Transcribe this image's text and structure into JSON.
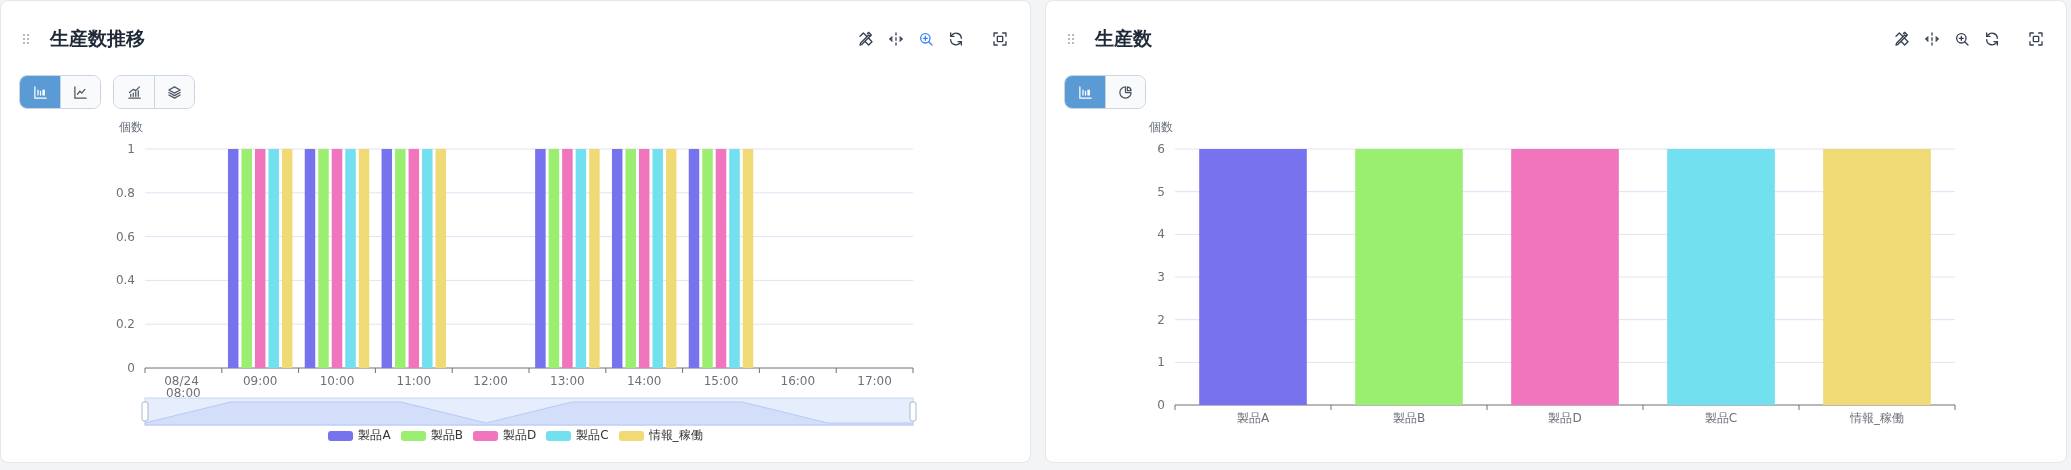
{
  "panels": [
    {
      "title": "生産数推移",
      "toolbar": [
        {
          "kind": "edit",
          "active": false
        },
        {
          "kind": "move",
          "active": false
        },
        {
          "kind": "zoom",
          "active": true
        },
        {
          "kind": "refresh",
          "active": false
        },
        {
          "kind": "fullscreen",
          "active": false
        }
      ],
      "view_groups": [
        [
          {
            "kind": "bar",
            "selected": true
          },
          {
            "kind": "line",
            "selected": false
          }
        ],
        [
          {
            "kind": "trend",
            "selected": false
          },
          {
            "kind": "stack",
            "selected": false
          }
        ]
      ],
      "zoom_slider": true,
      "chart_data": {
        "type": "bar",
        "ylabel": "個数",
        "categories": [
          "08/24 08:00",
          "09:00",
          "10:00",
          "11:00",
          "12:00",
          "13:00",
          "14:00",
          "15:00",
          "16:00",
          "17:00"
        ],
        "yticks": [
          {
            "value": 0,
            "label": "0"
          },
          {
            "value": 0.2,
            "label": "0.2"
          },
          {
            "value": 0.4,
            "label": "0.4"
          },
          {
            "value": 0.6,
            "label": "0.6"
          },
          {
            "value": 0.8,
            "label": "0.8"
          },
          {
            "value": 1,
            "label": "1"
          }
        ],
        "ylim": [
          0,
          1
        ],
        "grid": true,
        "legend": "bottom",
        "series": [
          {
            "name": "製品A",
            "color": "#7773ef",
            "values": [
              0,
              1,
              1,
              1,
              0,
              1,
              1,
              1,
              0,
              0
            ]
          },
          {
            "name": "製品B",
            "color": "#9bef70",
            "values": [
              0,
              1,
              1,
              1,
              0,
              1,
              1,
              1,
              0,
              0
            ]
          },
          {
            "name": "製品D",
            "color": "#f075bc",
            "values": [
              0,
              1,
              1,
              1,
              0,
              1,
              1,
              1,
              0,
              0
            ]
          },
          {
            "name": "製品C",
            "color": "#73e0ef",
            "values": [
              0,
              1,
              1,
              1,
              0,
              1,
              1,
              1,
              0,
              0
            ]
          },
          {
            "name": "情報_稼働",
            "color": "#f0da76",
            "values": [
              0,
              1,
              1,
              1,
              0,
              1,
              1,
              1,
              0,
              0
            ]
          }
        ]
      }
    },
    {
      "title": "生産数",
      "toolbar": [
        {
          "kind": "edit",
          "active": false
        },
        {
          "kind": "move",
          "active": false
        },
        {
          "kind": "zoom",
          "active": false
        },
        {
          "kind": "refresh",
          "active": false
        },
        {
          "kind": "fullscreen",
          "active": false
        }
      ],
      "view_groups": [
        [
          {
            "kind": "bar",
            "selected": true
          },
          {
            "kind": "pie",
            "selected": false
          }
        ]
      ],
      "chart_data": {
        "type": "bar",
        "ylabel": "個数",
        "categories": [
          "製品A",
          "製品B",
          "製品D",
          "製品C",
          "情報_稼働"
        ],
        "yticks": [
          {
            "value": 0,
            "label": "0"
          },
          {
            "value": 1,
            "label": "1"
          },
          {
            "value": 2,
            "label": "2"
          },
          {
            "value": 3,
            "label": "3"
          },
          {
            "value": 4,
            "label": "4"
          },
          {
            "value": 5,
            "label": "5"
          },
          {
            "value": 6,
            "label": "6"
          }
        ],
        "ylim": [
          0,
          6
        ],
        "grid": true,
        "series": [
          {
            "colors": [
              "#7773ef",
              "#9bef70",
              "#f075bc",
              "#73e0ef",
              "#f0da76"
            ],
            "values": [
              6,
              6,
              6,
              6,
              6
            ]
          }
        ]
      }
    }
  ]
}
